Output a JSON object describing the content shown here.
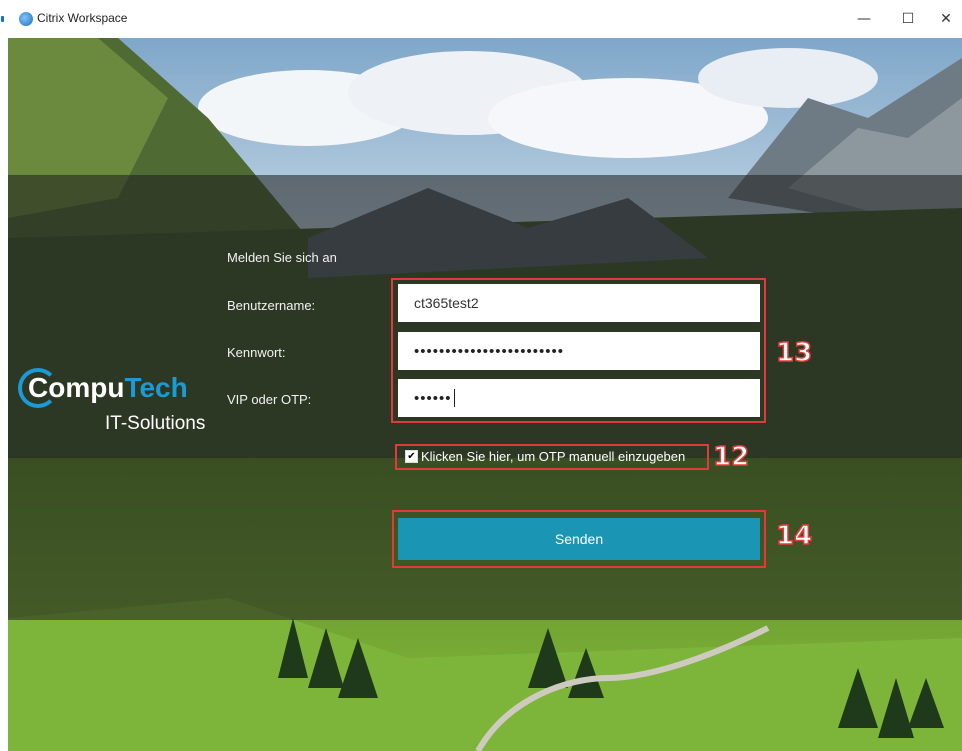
{
  "window": {
    "title": "Citrix Workspace",
    "minimize_glyph": "—",
    "maximize_glyph": "☐",
    "close_glyph": "✕"
  },
  "form": {
    "heading": "Melden Sie sich an",
    "username_label": "Benutzername:",
    "username_value": "ct365test2",
    "password_label": "Kennwort:",
    "password_value": "••••••••••••••••••••••••",
    "otp_label": "VIP oder OTP:",
    "otp_value": "••••••",
    "otp_checkbox_label": "Klicken Sie hier, um OTP manuell einzugeben",
    "otp_checkbox_checked": true,
    "submit_label": "Senden"
  },
  "logo": {
    "brand_part1": "Compu",
    "brand_part2": "Tech",
    "subtitle": "IT-Solutions"
  },
  "annotations": {
    "fields_number": "13",
    "checkbox_number": "12",
    "button_number": "14",
    "color": "#e03a3a"
  },
  "colors": {
    "button": "#1a95b4",
    "brand_accent": "#1a9ad6"
  }
}
